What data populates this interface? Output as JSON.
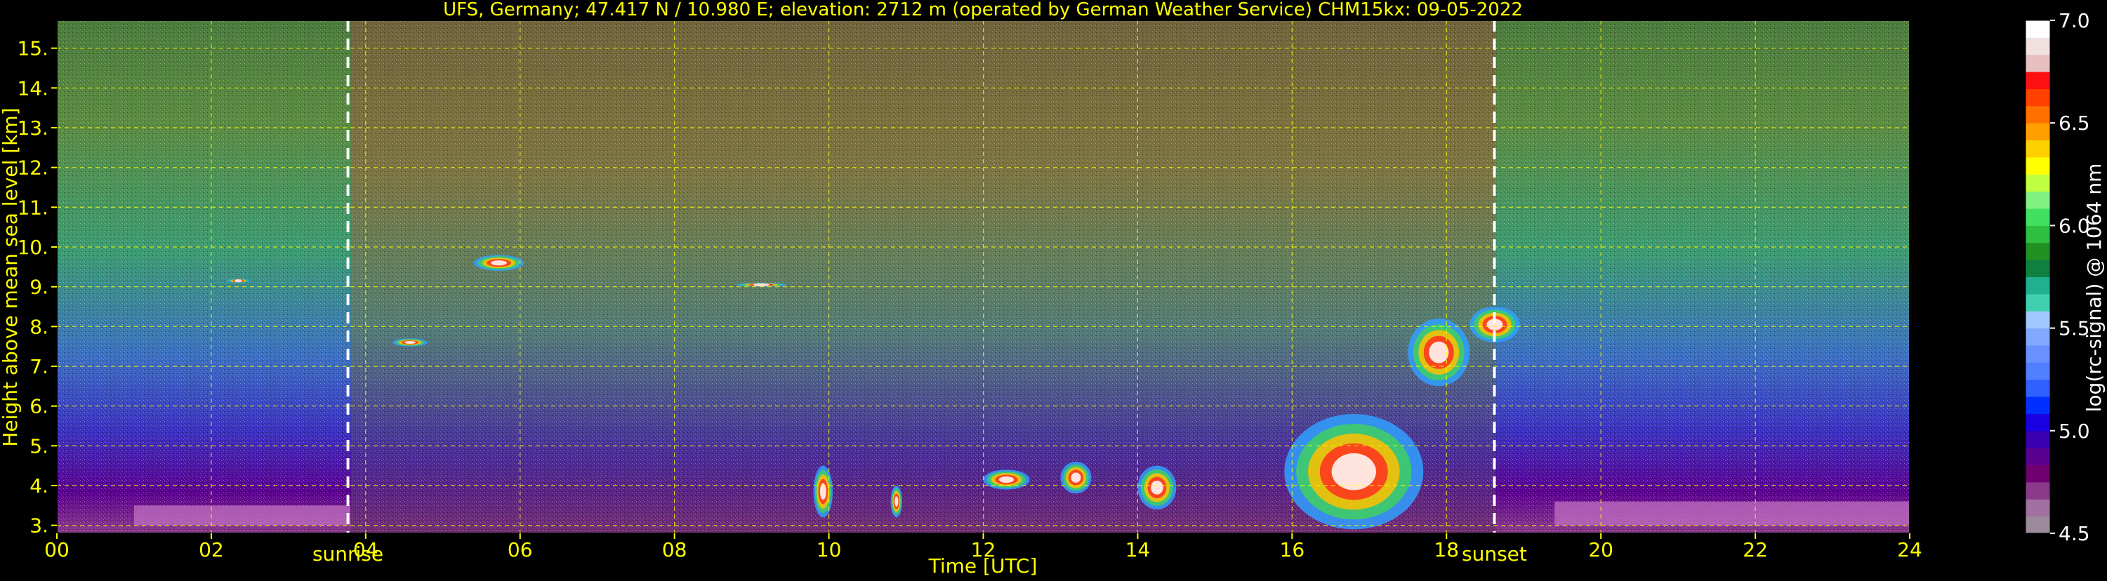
{
  "colors": {
    "background": "#000000",
    "title_text": "#ffff00",
    "axis_text": "#ffff00",
    "grid": "#ffff00",
    "annotation": "#ffff00",
    "colorbar_text": "#ffffff",
    "day_night_line": "#ffffff"
  },
  "chart_data": {
    "type": "heatmap",
    "title": "UFS, Germany; 47.417 N / 10.980 E; elevation: 2712 m  (operated by German Weather Service)    CHM15kx: 09-05-2022",
    "xlabel": "Time [UTC]",
    "ylabel": "Height above mean sea level [km]",
    "xlim": [
      0,
      24
    ],
    "ylim": [
      2.8,
      15.7
    ],
    "x_ticks": [
      0,
      2,
      4,
      6,
      8,
      10,
      12,
      14,
      16,
      18,
      20,
      22,
      24
    ],
    "x_tick_labels": [
      "00",
      "02",
      "04",
      "06",
      "08",
      "10",
      "12",
      "14",
      "16",
      "18",
      "20",
      "22",
      "24"
    ],
    "y_ticks": [
      3,
      4,
      5,
      6,
      7,
      8,
      9,
      10,
      11,
      12,
      13,
      14,
      15
    ],
    "y_tick_labels": [
      "3.",
      "4.",
      "5.",
      "6.",
      "7.",
      "8.",
      "9.",
      "10.",
      "11.",
      "12.",
      "13.",
      "14.",
      "15."
    ],
    "grid": true,
    "annotations": [
      {
        "label": "sunrise",
        "x": 3.77
      },
      {
        "label": "sunset",
        "x": 18.62
      }
    ],
    "colorbar": {
      "label": "log(rc-signal) @ 1064 nm",
      "range": [
        4.5,
        7.0
      ],
      "ticks": [
        4.5,
        5.0,
        5.5,
        6.0,
        6.5,
        7.0
      ],
      "tick_labels": [
        "4.5",
        "5.0",
        "5.5",
        "6.0",
        "6.5",
        "7.0"
      ],
      "colors": [
        "#9a8a9a",
        "#a070a0",
        "#8a3a8a",
        "#700070",
        "#5a0090",
        "#3a00b0",
        "#1a00e0",
        "#0030ff",
        "#3060ff",
        "#5080ff",
        "#6a90ff",
        "#80a8ff",
        "#a0c8ff",
        "#40d0b0",
        "#20b090",
        "#108040",
        "#209020",
        "#30c040",
        "#40e060",
        "#80f080",
        "#c0ff40",
        "#ffff00",
        "#ffd000",
        "#ffa000",
        "#ff7000",
        "#ff4000",
        "#ff1010",
        "#e8c0c0",
        "#f0e0e0",
        "#ffffff"
      ]
    },
    "features": [
      {
        "name": "cloud-layer",
        "x": [
          8.8,
          9.45
        ],
        "y": [
          9.0,
          9.1
        ]
      },
      {
        "name": "cloud-layer",
        "x": [
          5.4,
          6.05
        ],
        "y": [
          9.4,
          9.8
        ]
      },
      {
        "name": "cloud-layer",
        "x": [
          4.35,
          4.8
        ],
        "y": [
          7.5,
          7.7
        ]
      },
      {
        "name": "cloud-layer",
        "x": [
          2.2,
          2.5
        ],
        "y": [
          9.1,
          9.2
        ]
      },
      {
        "name": "cloud-layer",
        "x": [
          9.8,
          10.05
        ],
        "y": [
          3.2,
          4.5
        ]
      },
      {
        "name": "cloud-layer",
        "x": [
          10.8,
          10.95
        ],
        "y": [
          3.2,
          4.0
        ]
      },
      {
        "name": "cloud-layer",
        "x": [
          12.0,
          12.6
        ],
        "y": [
          3.9,
          4.4
        ]
      },
      {
        "name": "cloud-layer",
        "x": [
          13.0,
          13.4
        ],
        "y": [
          3.8,
          4.6
        ]
      },
      {
        "name": "cloud-layer",
        "x": [
          14.0,
          14.5
        ],
        "y": [
          3.4,
          4.5
        ]
      },
      {
        "name": "cloud-layer",
        "x": [
          15.9,
          17.7
        ],
        "y": [
          2.9,
          5.8
        ]
      },
      {
        "name": "cloud-layer",
        "x": [
          17.5,
          18.3
        ],
        "y": [
          6.5,
          8.2
        ]
      },
      {
        "name": "cloud-layer",
        "x": [
          18.3,
          18.95
        ],
        "y": [
          7.6,
          8.5
        ]
      },
      {
        "name": "aerosol-layer",
        "x": [
          1.0,
          3.8
        ],
        "y": [
          3.0,
          3.5
        ]
      },
      {
        "name": "aerosol-layer",
        "x": [
          19.4,
          24.0
        ],
        "y": [
          3.0,
          3.6
        ]
      }
    ]
  }
}
